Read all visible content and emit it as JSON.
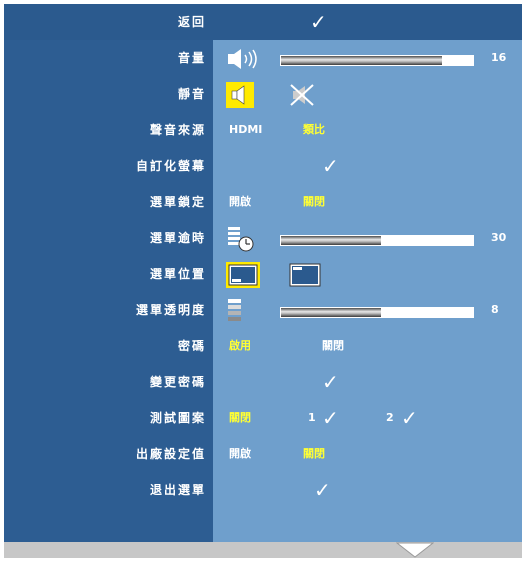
{
  "menu": {
    "rows": [
      {
        "label": "返回"
      },
      {
        "label": "音量",
        "value": "16",
        "level_percent": 84
      },
      {
        "label": "靜音"
      },
      {
        "label": "聲音來源",
        "option1": "HDMI",
        "option2": "類比"
      },
      {
        "label": "自訂化螢幕"
      },
      {
        "label": "選單鎖定",
        "option1": "開啟",
        "option2": "關閉"
      },
      {
        "label": "選單逾時",
        "value": "30",
        "level_percent": 52
      },
      {
        "label": "選單位置"
      },
      {
        "label": "選單透明度",
        "value": "8",
        "level_percent": 52
      },
      {
        "label": "密碼",
        "option1": "啟用",
        "option2": "關閉"
      },
      {
        "label": "變更密碼"
      },
      {
        "label": "測試圖案",
        "option1": "關閉",
        "option2": "1",
        "option3": "2"
      },
      {
        "label": "出廠設定值",
        "option1": "開啟",
        "option2": "關閉"
      },
      {
        "label": "退出選單"
      }
    ]
  },
  "icons": {
    "check": "checkmark-icon",
    "speaker": "speaker-icon",
    "mute": "speaker-muted-icon",
    "timer": "menu-timer-icon",
    "position": "menu-position-icon",
    "transparency": "menu-transparency-icon",
    "scroll": "scroll-down-arrow-icon"
  },
  "colors": {
    "background": "#2d5d92",
    "value_panel": "#6f9fcc",
    "selected": "#ffff33",
    "highlight": "#ffea00",
    "footer": "#c7c7c7"
  }
}
